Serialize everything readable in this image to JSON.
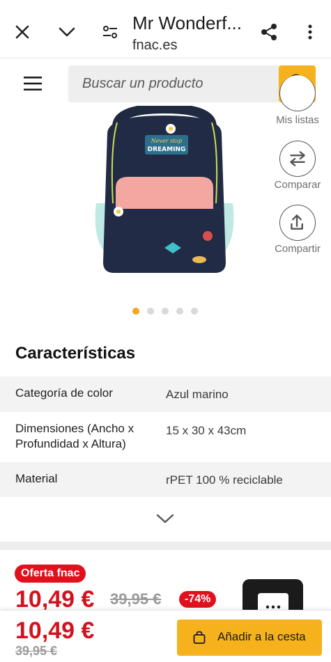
{
  "browser": {
    "title": "Mr Wonderf...",
    "url": "fnac.es",
    "icons": [
      "close-icon",
      "chevron-down-icon",
      "tune-icon",
      "share-icon",
      "more-vert-icon"
    ]
  },
  "search": {
    "placeholder": "Buscar un producto"
  },
  "side_actions": {
    "lists": "Mis listas",
    "compare": "Comparar",
    "share": "Compartir"
  },
  "gallery": {
    "total": 5,
    "active_index": 0,
    "badge_text": "Never stop DREAMING"
  },
  "characteristics": {
    "title": "Características",
    "rows": [
      {
        "key": "Categoría de color",
        "value": "Azul marino"
      },
      {
        "key": "Dimensiones (Ancho x Profundidad x Altura)",
        "value": "15 x 30 x 43cm"
      },
      {
        "key": "Material",
        "value": "rPET 100 % reciclable"
      }
    ]
  },
  "offer": {
    "badge": "Oferta fnac",
    "price": "10,49 €",
    "old_price": "39,95 €",
    "discount": "-74%"
  },
  "bottom_bar": {
    "price": "10,49 €",
    "old_price": "39,95 €",
    "cart_label": "Añadir a la cesta"
  },
  "colors": {
    "accent": "#f5b21c",
    "price_red": "#d4121e",
    "badge_red": "#e1101d",
    "dot_active": "#f5a623"
  }
}
